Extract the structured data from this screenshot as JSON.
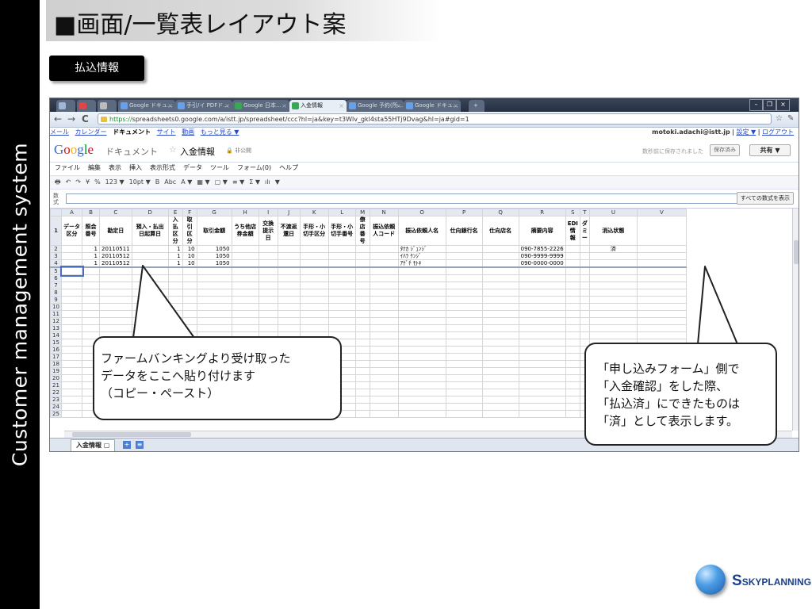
{
  "slide": {
    "sidebar_text": "Customer management system",
    "title": "■画面/一覧表レイアウト案",
    "section_label": "払込情報"
  },
  "browser": {
    "tabs": [
      "Google ドキュ...",
      "手引/イ PDFド...",
      "Google 日本...",
      "入金情報",
      "Google 予約(所...",
      "Google ドキュ..."
    ],
    "active_tab_index": 3,
    "new_tab_label": "+",
    "window_controls": [
      "–",
      "❐",
      "×"
    ],
    "url_scheme": "https://",
    "url_rest": "spreadsheets0.google.com/a/istt.jp/spreadsheet/ccc?hl=ja&key=t3Wlv_gkl4sta55HTj9Dvag&hl=ja#gid=1",
    "google_links": [
      "メール",
      "カレンダー",
      "ドキュメント",
      "サイト",
      "動画",
      "もっと見る ▼"
    ],
    "google_links_current_index": 2,
    "user_email": "motoki.adachi@istt.jp",
    "user_links": [
      "設定 ▼",
      "ログアウト"
    ]
  },
  "doc": {
    "logo_text": "Google",
    "product": "ドキュメント",
    "star": "☆",
    "name": "入金情報",
    "privacy": "🔒 非公開",
    "saved_message": "数秒前に保存されました",
    "save_label": "保存済み",
    "share_label": "共有 ▼"
  },
  "menu": [
    "ファイル",
    "編集",
    "表示",
    "挿入",
    "表示形式",
    "データ",
    "ツール",
    "フォーム(0)",
    "ヘルプ"
  ],
  "toolbar": [
    "🖶",
    "↶",
    "↷",
    "¥",
    "%",
    "123 ▼",
    "10pt ▼",
    "B",
    "Abc",
    "A ▼",
    "▦ ▼",
    "▢ ▼",
    "≡ ▼",
    "Σ ▼",
    "ılı",
    "▼"
  ],
  "formula": {
    "label": "数式",
    "show_all": "すべての数式を表示"
  },
  "sheet": {
    "columns": [
      "A",
      "B",
      "C",
      "D",
      "E",
      "F",
      "G",
      "H",
      "I",
      "J",
      "K",
      "L",
      "M",
      "N",
      "O",
      "P",
      "Q",
      "R",
      "S",
      "T",
      "U",
      "V"
    ],
    "header_row": [
      "データ区分",
      "照会番号",
      "勘定日",
      "預入・払出日起算日",
      "入払区分",
      "取引区分",
      "取引金額",
      "うち他店券金額",
      "交換提示日",
      "不渡返還日",
      "手形・小切手区分",
      "手形・小切手番号",
      "僚店番号",
      "振込依頼人コード",
      "振込依頼人名",
      "仕向銀行名",
      "仕向店名",
      "摘要内容",
      "EDI情報",
      "ダミー",
      "消込状態",
      ""
    ],
    "rows": [
      [
        "",
        "1",
        "20110511",
        "",
        "1",
        "10",
        "1050",
        "",
        "",
        "",
        "",
        "",
        "",
        "",
        "ﾀﾅｶ ｼﾞｭﾝｼﾞ",
        "",
        "",
        "090-7855-2226",
        "",
        "",
        "済",
        ""
      ],
      [
        "",
        "1",
        "20110512",
        "",
        "1",
        "10",
        "1050",
        "",
        "",
        "",
        "",
        "",
        "",
        "",
        "ｲﾊﾗ ｹﾝｼﾞ",
        "",
        "",
        "090-9999-9999",
        "",
        "",
        "",
        ""
      ],
      [
        "",
        "1",
        "20110512",
        "",
        "1",
        "10",
        "1050",
        "",
        "",
        "",
        "",
        "",
        "",
        "",
        "ｱｹﾞﾁ ﾓﾄｷ",
        "",
        "",
        "090-0000-0000",
        "",
        "",
        "",
        ""
      ]
    ],
    "row_numbers": [
      "1",
      "2",
      "3",
      "4",
      "5",
      "6",
      "7",
      "8",
      "9",
      "10",
      "11",
      "12",
      "13",
      "14",
      "15",
      "16",
      "17",
      "18",
      "19",
      "20",
      "21",
      "22",
      "23",
      "24",
      "25"
    ],
    "sheet_tab": "入金情報 ▢",
    "sheet_buttons": [
      "+",
      "≡"
    ]
  },
  "callouts": {
    "left": [
      "ファームバンキングより受け取った",
      "データをここへ貼り付けます",
      "（コピー・ペースト）"
    ],
    "right": [
      "「申し込みフォーム」側で",
      "「入金確認」をした際、",
      "「払込済」にできたものは",
      "「済」として表示します。"
    ]
  },
  "logo": {
    "initial": "S",
    "name": "SKYPLANNING"
  }
}
